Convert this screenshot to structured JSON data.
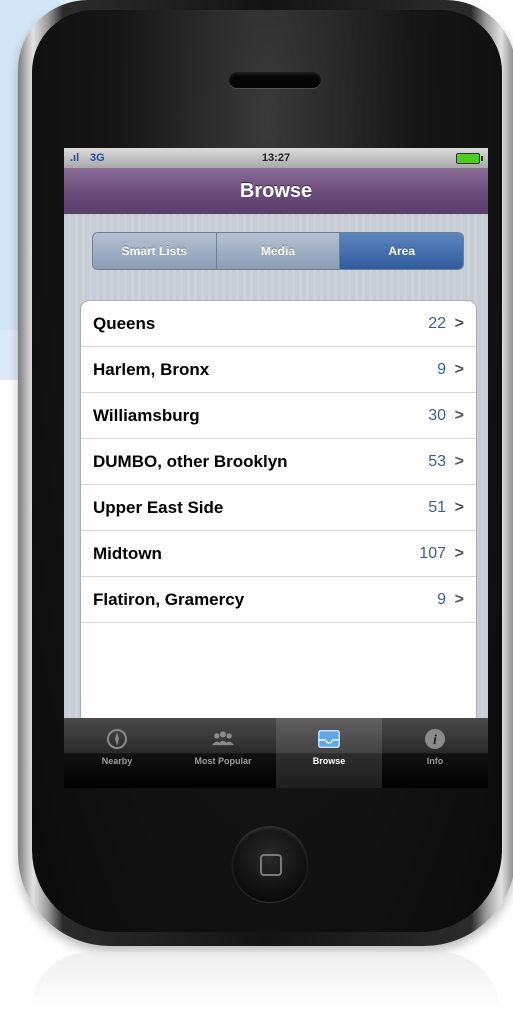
{
  "status_bar": {
    "network": "3G",
    "time": "13:27"
  },
  "nav": {
    "title": "Browse"
  },
  "segmented": {
    "items": [
      {
        "label": "Smart Lists",
        "active": false
      },
      {
        "label": "Media",
        "active": false
      },
      {
        "label": "Area",
        "active": true
      }
    ]
  },
  "list": {
    "items": [
      {
        "label": "Queens",
        "count": "22"
      },
      {
        "label": "Harlem, Bronx",
        "count": "9"
      },
      {
        "label": "Williamsburg",
        "count": "30"
      },
      {
        "label": "DUMBO, other Brooklyn",
        "count": "53"
      },
      {
        "label": "Upper East Side",
        "count": "51"
      },
      {
        "label": "Midtown",
        "count": "107"
      },
      {
        "label": "Flatiron, Gramercy",
        "count": "9"
      }
    ]
  },
  "tabbar": {
    "items": [
      {
        "label": "Nearby",
        "icon": "compass-icon",
        "active": false
      },
      {
        "label": "Most Popular",
        "icon": "people-icon",
        "active": false
      },
      {
        "label": "Browse",
        "icon": "inbox-icon",
        "active": true
      },
      {
        "label": "Info",
        "icon": "info-icon",
        "active": false
      }
    ]
  },
  "colors": {
    "nav_purple": "#6b4e7c",
    "segment_active": "#2f5c9e",
    "count_blue": "#3d5e9a"
  }
}
